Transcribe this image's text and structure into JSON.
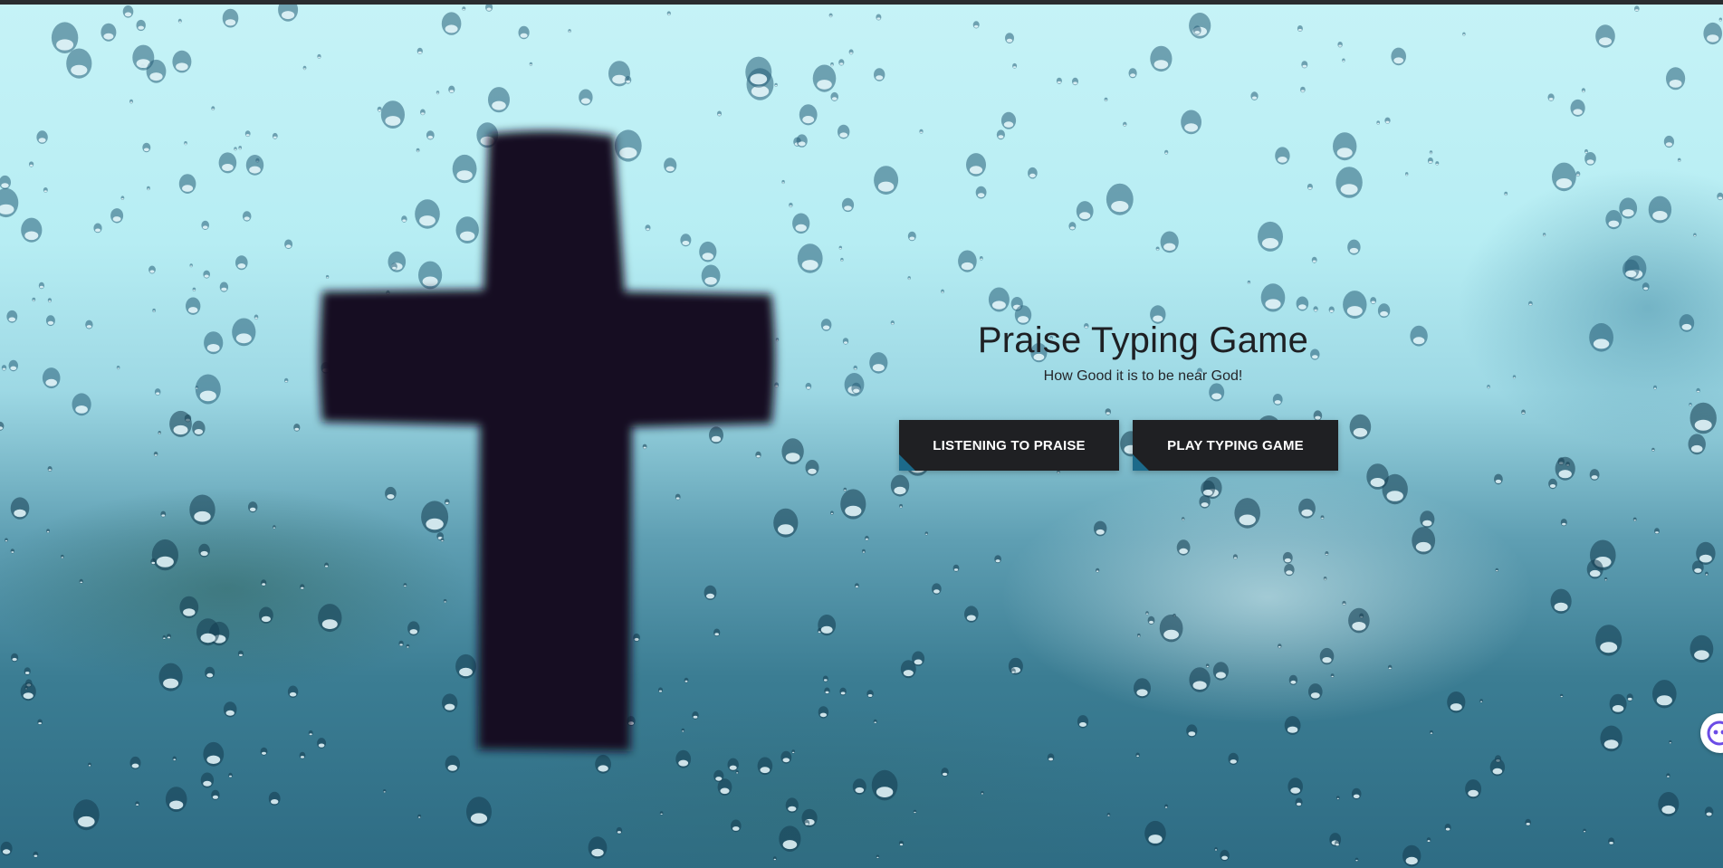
{
  "hero": {
    "title": "Praise Typing Game",
    "subtitle": "How Good it is to be near God!"
  },
  "buttons": {
    "listen_label": "LISTENING TO PRAISE",
    "play_label": "PLAY TYPING GAME"
  },
  "colors": {
    "button_bg": "#1f2023",
    "button_accent": "#1c6a8a",
    "title_text": "#1e2024",
    "chat_accent": "#6b4ce6"
  },
  "icons": {
    "chat": "chat-bot-icon"
  }
}
